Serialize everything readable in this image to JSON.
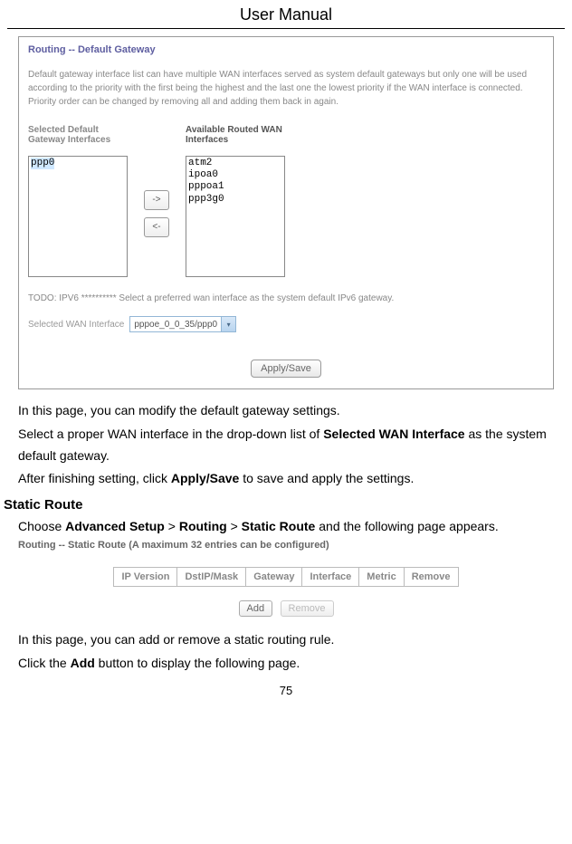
{
  "header": {
    "title": "User Manual"
  },
  "gateway_panel": {
    "title": "Routing -- Default Gateway",
    "description": "Default gateway interface list can have multiple WAN interfaces served as system default gateways but only one will be used according to the priority with the first being the highest and the last one the lowest priority if the WAN interface is connected. Priority order can be changed by removing all and adding them back in again.",
    "selected_label": "Selected Default Gateway Interfaces",
    "available_label": "Available Routed WAN Interfaces",
    "selected_items": [
      "ppp0"
    ],
    "available_items": [
      "atm2",
      "ipoa0",
      "pppoa1",
      "ppp3g0"
    ],
    "arrow_right": "->",
    "arrow_left": "<-",
    "todo": "TODO: IPV6 ********** Select a preferred wan interface as the system default IPv6 gateway.",
    "swan_label": "Selected WAN Interface",
    "swan_value": "pppoe_0_0_35/ppp0",
    "apply_label": "Apply/Save"
  },
  "body": {
    "p1": "In this page, you can modify the default gateway settings.",
    "p2a": "Select a proper WAN interface in the drop-down list of ",
    "p2b": "Selected WAN Interface",
    "p2c": " as the system default gateway.",
    "p3a": "After finishing setting, click ",
    "p3b": "Apply/Save",
    "p3c": " to save and apply the settings.",
    "heading": "Static Route",
    "p4a": "Choose ",
    "p4b": "Advanced Setup",
    "p4c": " > ",
    "p4d": "Routing",
    "p4e": " > ",
    "p4f": "Static Route",
    "p4g": " and the following page appears."
  },
  "static_panel": {
    "title": "Routing -- Static Route (A maximum 32 entries can be configured)",
    "headers": [
      "IP Version",
      "DstIP/Mask",
      "Gateway",
      "Interface",
      "Metric",
      "Remove"
    ],
    "add_label": "Add",
    "remove_label": "Remove"
  },
  "body2": {
    "p5": "In this page, you can add or remove a static routing rule.",
    "p6a": "Click the ",
    "p6b": "Add",
    "p6c": " button to display the following page."
  },
  "page_number": "75"
}
